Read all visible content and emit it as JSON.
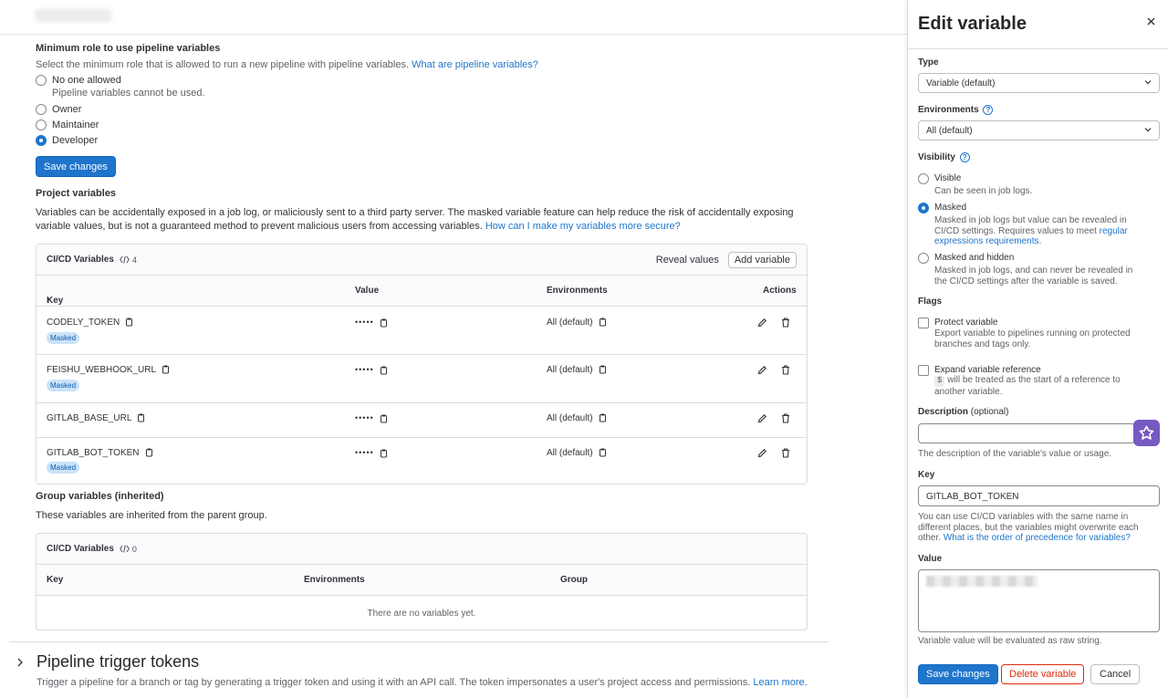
{
  "pipeline_vars": {
    "title": "Minimum role to use pipeline variables",
    "desc": "Select the minimum role that is allowed to run a new pipeline with pipeline variables.",
    "help_link": "What are pipeline variables?",
    "options": [
      {
        "label": "No one allowed",
        "help": "Pipeline variables cannot be used.",
        "selected": false
      },
      {
        "label": "Owner",
        "selected": false
      },
      {
        "label": "Maintainer",
        "selected": false
      },
      {
        "label": "Developer",
        "selected": true
      }
    ],
    "save_label": "Save changes"
  },
  "project_vars": {
    "title": "Project variables",
    "desc_line1": "Variables can be accidentally exposed in a job log, or maliciously sent to a third party server. The masked variable feature can help reduce the risk of accidentally exposing",
    "desc_line2": "variable values, but is not a guaranteed method to prevent malicious users from accessing variables.",
    "help_link": "How can I make my variables more secure?",
    "card_title": "CI/CD Variables",
    "count": "4",
    "reveal_label": "Reveal values",
    "add_label": "Add variable",
    "columns": {
      "key": "Key",
      "key_sort": "↑",
      "value": "Value",
      "env": "Environments",
      "actions": "Actions"
    },
    "rows": [
      {
        "key": "CODELY_TOKEN",
        "value": "•••••",
        "env": "All (default)",
        "badge": "Masked"
      },
      {
        "key": "FEISHU_WEBHOOK_URL",
        "value": "•••••",
        "env": "All (default)",
        "badge": "Masked"
      },
      {
        "key": "GITLAB_BASE_URL",
        "value": "•••••",
        "env": "All (default)",
        "badge": ""
      },
      {
        "key": "GITLAB_BOT_TOKEN",
        "value": "•••••",
        "env": "All (default)",
        "badge": "Masked"
      }
    ]
  },
  "group_vars": {
    "title": "Group variables (inherited)",
    "desc": "These variables are inherited from the parent group.",
    "card_title": "CI/CD Variables",
    "count": "0",
    "columns": {
      "key": "Key",
      "env": "Environments",
      "group": "Group"
    },
    "empty": "There are no variables yet."
  },
  "triggers": {
    "title": "Pipeline trigger tokens",
    "desc": "Trigger a pipeline for a branch or tag by generating a trigger token and using it with an API call. The token impersonates a user's project access and permissions.",
    "link": "Learn more."
  },
  "drawer": {
    "title": "Edit variable",
    "type_label": "Type",
    "type_value": "Variable (default)",
    "env_label": "Environments",
    "env_value": "All (default)",
    "visibility_label": "Visibility",
    "visibility": [
      {
        "label": "Visible",
        "help": "Can be seen in job logs.",
        "selected": false
      },
      {
        "label": "Masked",
        "help1": "Masked in job logs but value can be revealed in",
        "help2": "CI/CD settings. Requires values to meet",
        "help_link1": "regular",
        "help_link2": "expressions requirements.",
        "selected": true
      },
      {
        "label": "Masked and hidden",
        "help1": "Masked in job logs, and can never be revealed in",
        "help2": "the CI/CD settings after the variable is saved.",
        "selected": false
      }
    ],
    "flags_label": "Flags",
    "flags": [
      {
        "label": "Protect variable",
        "help1": "Export variable to pipelines running on protected",
        "help2": "branches and tags only."
      },
      {
        "label": "Expand variable reference",
        "code": "$",
        "help1": "will be treated as the start of a reference to",
        "help2": "another variable."
      }
    ],
    "desc_label": "Description",
    "desc_optional": "(optional)",
    "desc_value": "",
    "desc_help": "The description of the variable's value or usage.",
    "key_label": "Key",
    "key_value": "GITLAB_BOT_TOKEN",
    "key_help1": "You can use CI/CD variables with the same name in",
    "key_help2": "different places, but the variables might overwrite each",
    "key_help3": "other.",
    "key_link": "What is the order of precedence for variables?",
    "value_label": "Value",
    "value_help": "Variable value will be evaluated as raw string.",
    "save_label": "Save changes",
    "delete_label": "Delete variable",
    "cancel_label": "Cancel"
  },
  "colors": {
    "primary": "#1f75cb",
    "danger": "#dd2b0e",
    "badge_bg": "#cbe2f9",
    "ai_purple": "#7759c2"
  }
}
